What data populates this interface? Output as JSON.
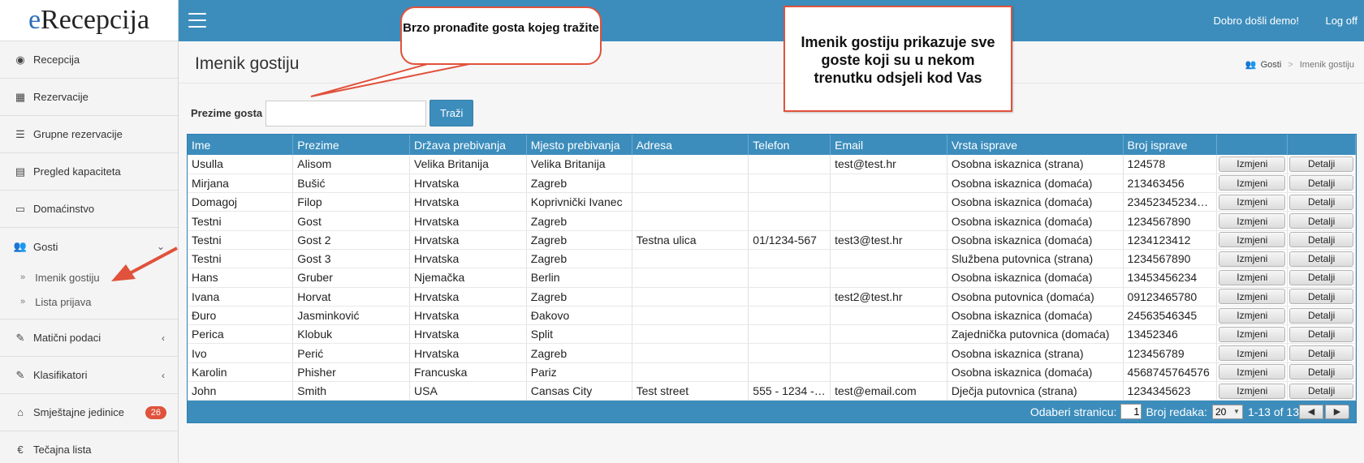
{
  "app": {
    "brand_e": "e",
    "brand_rest": "Recepcija"
  },
  "topbar": {
    "welcome": "Dobro došli demo!",
    "logoff": "Log off"
  },
  "sidebar": {
    "items": [
      {
        "label": "Recepcija",
        "icon": "dashboard-icon",
        "glyph": "◉"
      },
      {
        "label": "Rezervacije",
        "icon": "grid-icon",
        "glyph": "▦"
      },
      {
        "label": "Grupne rezervacije",
        "icon": "list-icon",
        "glyph": "☰"
      },
      {
        "label": "Pregled kapaciteta",
        "icon": "calendar-icon",
        "glyph": "▤"
      },
      {
        "label": "Domaćinstvo",
        "icon": "list-alt-icon",
        "glyph": "▭"
      },
      {
        "label": "Gosti",
        "icon": "users-icon",
        "glyph": "👥"
      },
      {
        "label": "Matični podaci",
        "icon": "edit-icon",
        "glyph": "✎"
      },
      {
        "label": "Klasifikatori",
        "icon": "edit-icon",
        "glyph": "✎"
      },
      {
        "label": "Smještajne jedinice",
        "icon": "home-icon",
        "glyph": "⌂",
        "badge": "26"
      },
      {
        "label": "Tečajna lista",
        "icon": "euro-icon",
        "glyph": "€"
      }
    ],
    "sub_items": [
      {
        "label": "Imenik gostiju"
      },
      {
        "label": "Lista prijava"
      }
    ]
  },
  "page": {
    "title": "Imenik gostiju",
    "breadcrumb": {
      "parent": "Gosti",
      "separator": ">",
      "current": "Imenik gostiju"
    }
  },
  "search": {
    "label": "Prezime gosta",
    "value": "",
    "button": "Traži"
  },
  "table": {
    "headers": [
      "Ime",
      "Prezime",
      "Država prebivanja",
      "Mjesto prebivanja",
      "Adresa",
      "Telefon",
      "Email",
      "Vrsta isprave",
      "Broj isprave",
      "",
      ""
    ],
    "button_edit": "Izmjeni",
    "button_details": "Detalji",
    "rows": [
      [
        "Usulla",
        "Alisom",
        "Velika Britanija",
        "Velika Britanija",
        "",
        "",
        "test@test.hr",
        "Osobna iskaznica (strana)",
        "124578"
      ],
      [
        "Mirjana",
        "Bušić",
        "Hrvatska",
        "Zagreb",
        "",
        "",
        "",
        "Osobna iskaznica (domaća)",
        "213463456"
      ],
      [
        "Domagoj",
        "Filop",
        "Hrvatska",
        "Koprivnički Ivanec",
        "",
        "",
        "",
        "Osobna iskaznica (domaća)",
        "23452345234…"
      ],
      [
        "Testni",
        "Gost",
        "Hrvatska",
        "Zagreb",
        "",
        "",
        "",
        "Osobna iskaznica (domaća)",
        "1234567890"
      ],
      [
        "Testni",
        "Gost 2",
        "Hrvatska",
        "Zagreb",
        "Testna ulica",
        "01/1234-567",
        "test3@test.hr",
        "Osobna iskaznica (domaća)",
        "1234123412"
      ],
      [
        "Testni",
        "Gost 3",
        "Hrvatska",
        "Zagreb",
        "",
        "",
        "",
        "Službena putovnica (strana)",
        "1234567890"
      ],
      [
        "Hans",
        "Gruber",
        "Njemačka",
        "Berlin",
        "",
        "",
        "",
        "Osobna iskaznica (domaća)",
        "13453456234"
      ],
      [
        "Ivana",
        "Horvat",
        "Hrvatska",
        "Zagreb",
        "",
        "",
        "test2@test.hr",
        "Osobna putovnica (domaća)",
        "09123465780"
      ],
      [
        "Đuro",
        "Jasminković",
        "Hrvatska",
        "Đakovo",
        "",
        "",
        "",
        "Osobna iskaznica (domaća)",
        "24563546345"
      ],
      [
        "Perica",
        "Klobuk",
        "Hrvatska",
        "Split",
        "",
        "",
        "",
        "Zajednička putovnica (domaća)",
        "13452346"
      ],
      [
        "Ivo",
        "Perić",
        "Hrvatska",
        "Zagreb",
        "",
        "",
        "",
        "Osobna iskaznica (strana)",
        "123456789"
      ],
      [
        "Karolin",
        "Phisher",
        "Francuska",
        "Pariz",
        "",
        "",
        "",
        "Osobna iskaznica (domaća)",
        "4568745764576"
      ],
      [
        "John",
        "Smith",
        "USA",
        "Cansas City",
        "Test street",
        "555 - 1234 - …",
        "test@email.com",
        "Dječja putovnica (strana)",
        "1234345623"
      ]
    ]
  },
  "pager": {
    "page_label": "Odaberi stranicu:",
    "page_value": "1",
    "rows_label": "Broj redaka:",
    "rows_value": "20",
    "range": "1-13 of 13",
    "prev": "◀",
    "next": "▶"
  },
  "callouts": {
    "search_hint": "Brzo pronađite gosta kojeg tražite",
    "directory_hint": "Imenik gostiju prikazuje sve goste koji su u nekom trenutku odsjeli kod Vas"
  },
  "colors": {
    "primary": "#3c8dbc",
    "annotation": "#e0523b"
  }
}
